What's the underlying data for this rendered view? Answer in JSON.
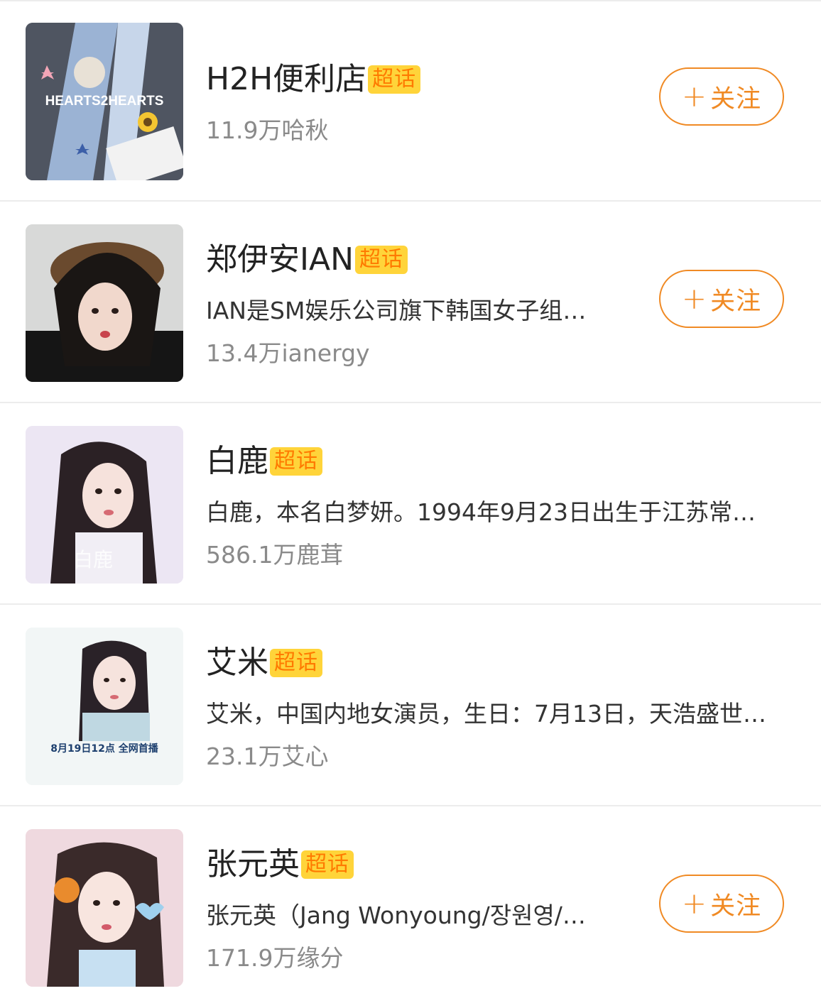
{
  "colors": {
    "accent": "#f08a24",
    "badge_bg": "#ffd43a",
    "badge_text": "#ff7a00",
    "divider": "#ececec",
    "meta_text": "#8a8a8a"
  },
  "items": [
    {
      "title": "H2H便利店",
      "badge": "超话",
      "desc": "",
      "meta": "11.9万哈秋",
      "follow_label": "关注",
      "follow_icon": "plus-icon",
      "avatar_text": "HEARTS2HEARTS",
      "show_follow": true
    },
    {
      "title": "郑伊安IAN",
      "badge": "超话",
      "desc": "IAN是SM娱乐公司旗下韩国女子组…",
      "meta": "13.4万ianergy",
      "follow_label": "关注",
      "follow_icon": "plus-icon",
      "avatar_text": "",
      "show_follow": true
    },
    {
      "title": "白鹿",
      "badge": "超话",
      "desc": "白鹿，本名白梦妍。1994年9月23日出生于江苏常…",
      "meta": "586.1万鹿茸",
      "follow_label": "",
      "follow_icon": "",
      "avatar_text": "白鹿",
      "show_follow": false
    },
    {
      "title": "艾米",
      "badge": "超话",
      "desc": "艾米，中国内地女演员，生日：7月13日，天浩盛世…",
      "meta": "23.1万艾心",
      "follow_label": "",
      "follow_icon": "",
      "avatar_text": "8月19日12点 全网首播",
      "show_follow": false
    },
    {
      "title": "张元英",
      "badge": "超话",
      "desc": "张元英（Jang Wonyoung/장원영/…",
      "meta": "171.9万缘分",
      "follow_label": "关注",
      "follow_icon": "plus-icon",
      "avatar_text": "",
      "show_follow": true
    }
  ]
}
